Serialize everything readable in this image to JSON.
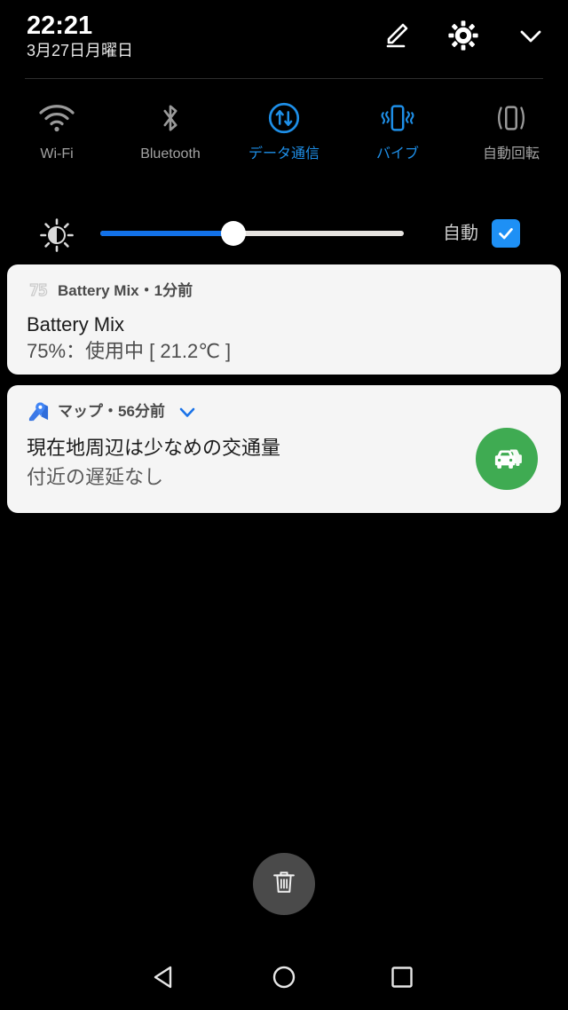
{
  "statusbar": {
    "time": "22:21",
    "date": "3月27日月曜日",
    "icons": [
      {
        "name": "edit-icon"
      },
      {
        "name": "settings-gear-icon"
      },
      {
        "name": "chevron-down-icon"
      }
    ]
  },
  "quick_settings": {
    "tiles": [
      {
        "label": "Wi-Fi",
        "icon": "wifi-icon",
        "enabled": false
      },
      {
        "label": "Bluetooth",
        "icon": "bluetooth-icon",
        "enabled": false
      },
      {
        "label": "データ通信",
        "icon": "mobile-data-icon",
        "enabled": true
      },
      {
        "label": "バイブ",
        "icon": "vibrate-icon",
        "enabled": true
      },
      {
        "label": "自動回転",
        "icon": "auto-rotate-icon",
        "enabled": false
      }
    ],
    "colors": {
      "on": "#1e8fe8",
      "off": "#a3a3a3"
    }
  },
  "brightness": {
    "icon": "brightness-icon",
    "value_percent": 44,
    "auto_label": "自動",
    "auto_checked": true,
    "fill_color": "#1271e8",
    "track_color": "#e6e3e0",
    "checkbox_color": "#1e90f5"
  },
  "notifications": [
    {
      "id": "battery",
      "app_icon": "battery-mix-icon",
      "app_icon_text": "75",
      "app_name": "Battery Mix・1分前",
      "title": "Battery Mix",
      "body": "75%：使用中 [ 21.2℃ ]",
      "expand_icon": null,
      "badge_icon": null
    },
    {
      "id": "maps",
      "app_icon": "google-maps-icon",
      "app_icon_text": "",
      "app_name": "マップ・56分前",
      "title": "現在地周辺は少なめの交通量",
      "body": "付近の遅延なし",
      "expand_icon": "chevron-down-icon",
      "badge_icon": "traffic-car-icon",
      "badge_color": "#3fab52"
    }
  ],
  "clear_all": {
    "icon": "trash-icon",
    "background": "#4a4a4a"
  },
  "navbar": {
    "buttons": [
      {
        "name": "back-button",
        "icon": "triangle-back-icon"
      },
      {
        "name": "home-button",
        "icon": "circle-home-icon"
      },
      {
        "name": "recents-button",
        "icon": "square-recents-icon"
      }
    ]
  }
}
